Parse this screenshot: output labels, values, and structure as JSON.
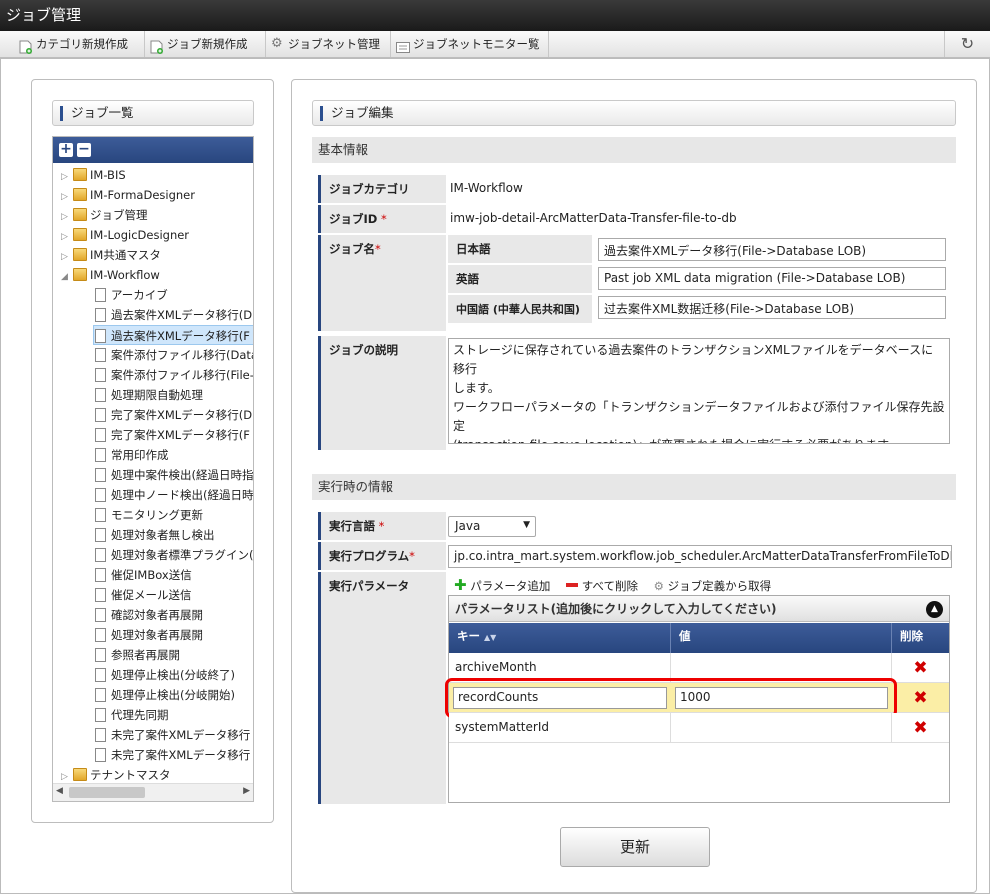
{
  "window": {
    "title": "ジョブ管理"
  },
  "toolbar": {
    "items": [
      "カテゴリ新規作成",
      "ジョブ新規作成",
      "ジョブネット管理",
      "ジョブネットモニター覧"
    ],
    "refresh_icon": "refresh-icon"
  },
  "left": {
    "heading": "ジョブ一覧",
    "tree": [
      {
        "label": "IM-BIS",
        "type": "folder",
        "level": 0,
        "expanded": false
      },
      {
        "label": "IM-FormaDesigner",
        "type": "folder",
        "level": 0,
        "expanded": false
      },
      {
        "label": "ジョブ管理",
        "type": "folder",
        "level": 0,
        "expanded": false
      },
      {
        "label": "IM-LogicDesigner",
        "type": "folder",
        "level": 0,
        "expanded": false
      },
      {
        "label": "IM共通マスタ",
        "type": "folder",
        "level": 0,
        "expanded": false
      },
      {
        "label": "IM-Workflow",
        "type": "folder",
        "level": 0,
        "expanded": true
      },
      {
        "label": "アーカイブ",
        "type": "doc",
        "level": 1
      },
      {
        "label": "過去案件XMLデータ移行(D",
        "type": "doc",
        "level": 1
      },
      {
        "label": "過去案件XMLデータ移行(F",
        "type": "doc",
        "level": 1,
        "selected": true
      },
      {
        "label": "案件添付ファイル移行(Data",
        "type": "doc",
        "level": 1
      },
      {
        "label": "案件添付ファイル移行(File-",
        "type": "doc",
        "level": 1
      },
      {
        "label": "処理期限自動処理",
        "type": "doc",
        "level": 1
      },
      {
        "label": "完了案件XMLデータ移行(D",
        "type": "doc",
        "level": 1
      },
      {
        "label": "完了案件XMLデータ移行(F",
        "type": "doc",
        "level": 1
      },
      {
        "label": "常用印作成",
        "type": "doc",
        "level": 1
      },
      {
        "label": "処理中案件検出(経過日時指",
        "type": "doc",
        "level": 1
      },
      {
        "label": "処理中ノード検出(経過日時",
        "type": "doc",
        "level": 1
      },
      {
        "label": "モニタリング更新",
        "type": "doc",
        "level": 1
      },
      {
        "label": "処理対象者無し検出",
        "type": "doc",
        "level": 1
      },
      {
        "label": "処理対象者標準プラグイン(",
        "type": "doc",
        "level": 1
      },
      {
        "label": "催促IMBox送信",
        "type": "doc",
        "level": 1
      },
      {
        "label": "催促メール送信",
        "type": "doc",
        "level": 1
      },
      {
        "label": "確認対象者再展開",
        "type": "doc",
        "level": 1
      },
      {
        "label": "処理対象者再展開",
        "type": "doc",
        "level": 1
      },
      {
        "label": "参照者再展開",
        "type": "doc",
        "level": 1
      },
      {
        "label": "処理停止検出(分岐終了)",
        "type": "doc",
        "level": 1
      },
      {
        "label": "処理停止検出(分岐開始)",
        "type": "doc",
        "level": 1
      },
      {
        "label": "代理先同期",
        "type": "doc",
        "level": 1
      },
      {
        "label": "未完了案件XMLデータ移行",
        "type": "doc",
        "level": 1
      },
      {
        "label": "未完了案件XMLデータ移行",
        "type": "doc",
        "level": 1
      },
      {
        "label": "テナントマスタ",
        "type": "folder",
        "level": 0,
        "expanded": false
      }
    ]
  },
  "right": {
    "heading": "ジョブ編集",
    "basic": {
      "heading": "基本情報",
      "category_label": "ジョブカテゴリ",
      "category_value": "IM-Workflow",
      "id_label": "ジョブID",
      "id_value": "imw-job-detail-ArcMatterData-Transfer-file-to-db",
      "name_label": "ジョブ名",
      "names": [
        {
          "lang": "日本語",
          "value": "過去案件XMLデータ移行(File->Database LOB)"
        },
        {
          "lang": "英語",
          "value": "Past job XML data migration (File->Database LOB)"
        },
        {
          "lang": "中国語 (中華人民共和国)",
          "value": "过去案件XML数据迁移(File->Database LOB)"
        }
      ],
      "desc_label": "ジョブの説明",
      "desc_lines": [
        "ストレージに保存されている過去案件のトランザクションXMLファイルをデータベースに移行",
        "します。",
        "ワークフローパラメータの「トランザクションデータファイルおよび添付ファイル保存先設定",
        "(transaction-file-save-location)」が変更された場合に実行する必要があります。"
      ]
    },
    "runtime": {
      "heading": "実行時の情報",
      "lang_label": "実行言語",
      "lang_value": "Java",
      "prog_label": "実行プログラム",
      "prog_value": "jp.co.intra_mart.system.workflow.job_scheduler.ArcMatterDataTransferFromFileToDB",
      "param_label": "実行パラメータ",
      "param_actions": [
        "パラメータ追加",
        "すべて削除",
        "ジョブ定義から取得"
      ],
      "list_title": "パラメータリスト(追加後にクリックして入力してください)",
      "columns": [
        "キー",
        "値",
        "削除"
      ],
      "rows": [
        {
          "key": "archiveMonth",
          "value": ""
        },
        {
          "key": "recordCounts",
          "value": "1000",
          "editing": true
        },
        {
          "key": "systemMatterId",
          "value": ""
        }
      ]
    },
    "update_button": "更新"
  },
  "colors": {
    "accent": "#28467f",
    "highlight": "#e00",
    "delete": "#d00000"
  }
}
